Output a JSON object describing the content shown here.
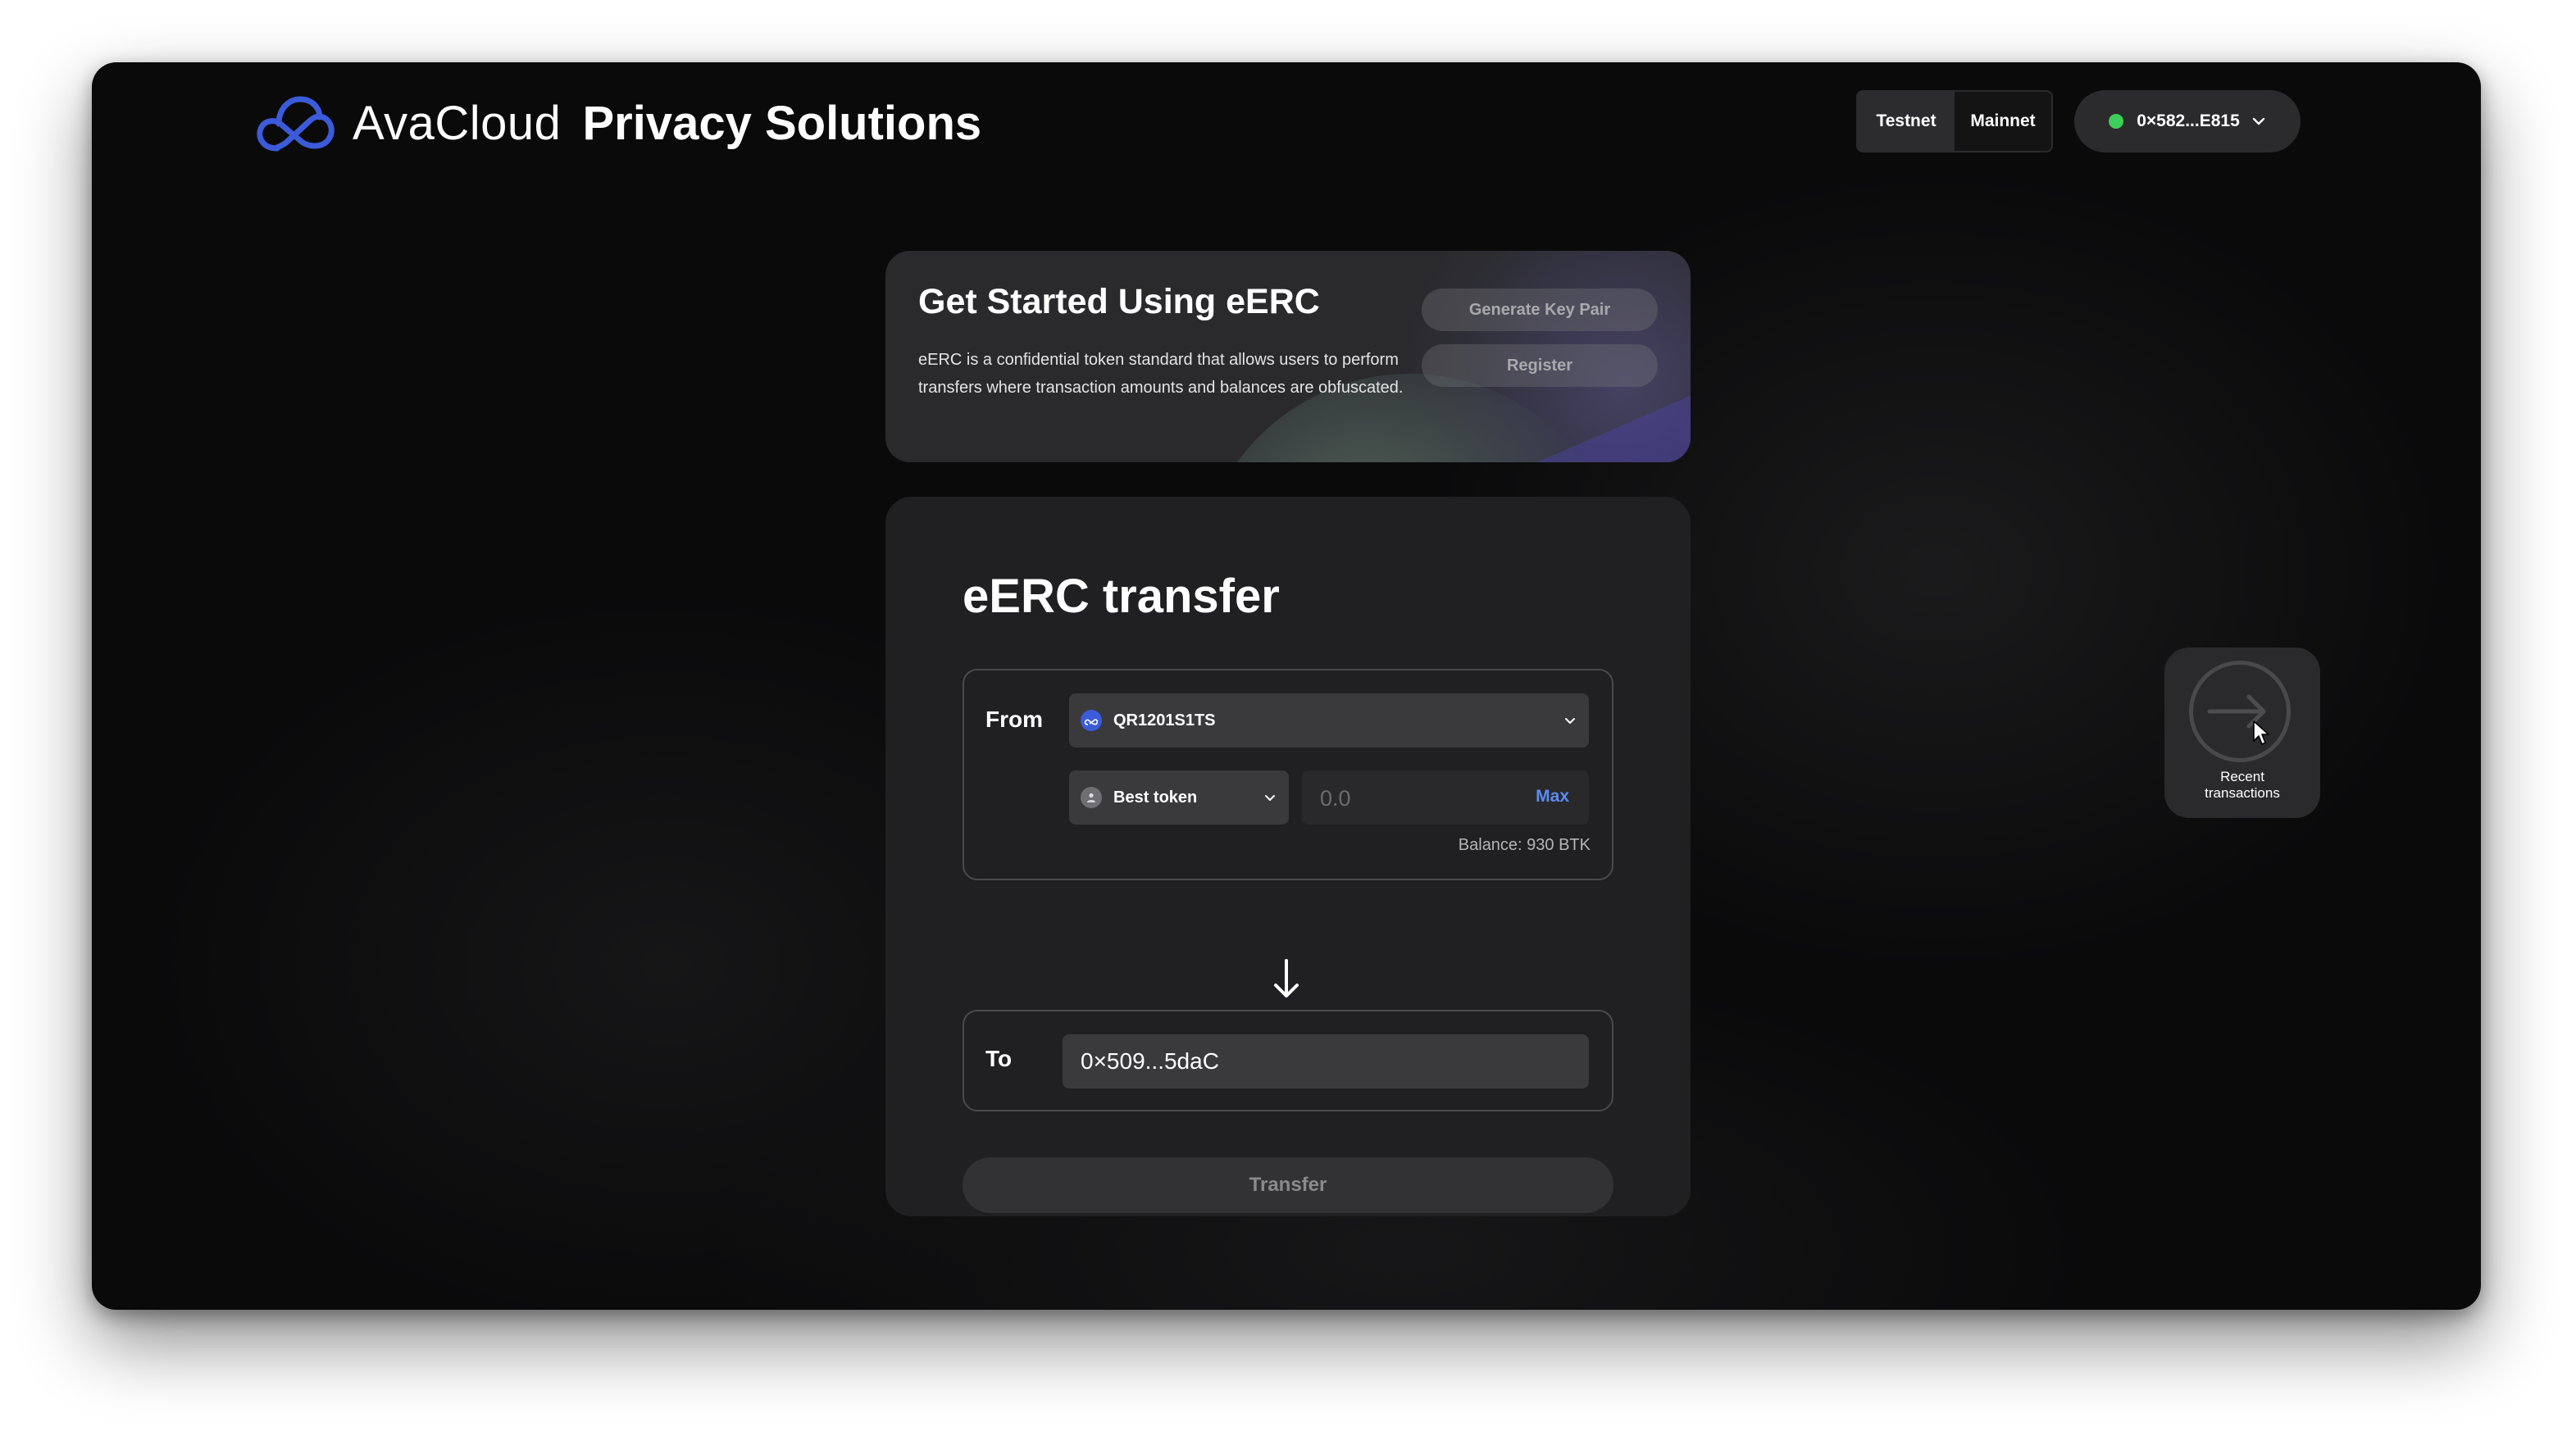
{
  "header": {
    "brand": "AvaCloud",
    "brand_sub": "Privacy Solutions",
    "network_options": [
      "Testnet",
      "Mainnet"
    ],
    "network_selected": "Testnet",
    "wallet_address": "0×582...E815",
    "wallet_status_color": "#3ccf5a"
  },
  "get_started": {
    "title": "Get Started Using eERC",
    "description": "eERC is a confidential token standard that allows users to perform transfers where transaction amounts and balances are obfuscated.",
    "generate_key_label": "Generate Key Pair",
    "register_label": "Register"
  },
  "transfer": {
    "title": "eERC transfer",
    "from_label": "From",
    "account_name": "QR1201S1TS",
    "token_name": "Best token",
    "amount_placeholder": "0.0",
    "max_label": "Max",
    "balance_text": "Balance: 930 BTK",
    "to_label": "To",
    "to_address": "0×509...5daC",
    "submit_label": "Transfer"
  },
  "recent": {
    "label_line1": "Recent",
    "label_line2": "transactions"
  },
  "colors": {
    "accent_blue": "#5b8bf2",
    "logo_blue": "#3b5bdb"
  }
}
